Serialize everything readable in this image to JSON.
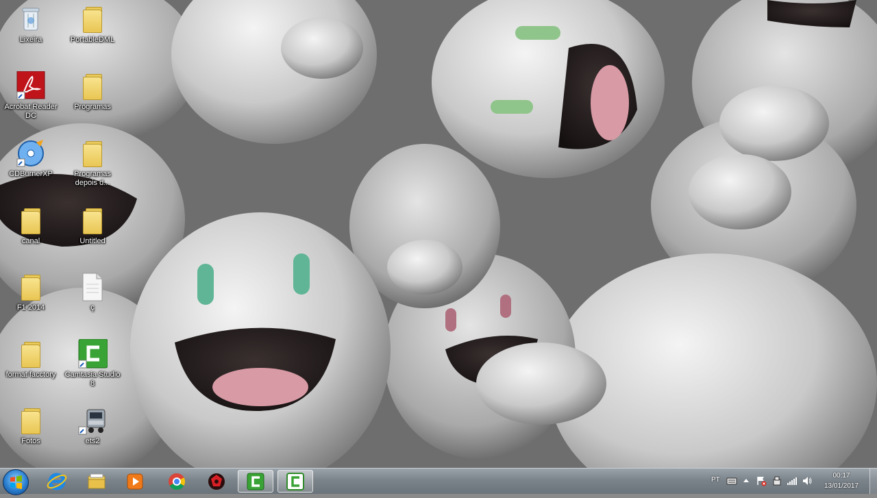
{
  "desktop": {
    "icons": [
      {
        "label": "Lixeira",
        "icon": "recycle-bin-icon"
      },
      {
        "label": "PortableDML",
        "icon": "folder-icon"
      },
      {
        "label": "Acrobat Reader DC",
        "icon": "acrobat-reader-icon"
      },
      {
        "label": "Programas",
        "icon": "folder-icon"
      },
      {
        "label": "CDBurnerXP",
        "icon": "cdburnerxp-icon"
      },
      {
        "label": "Programas depois d...",
        "icon": "folder-icon"
      },
      {
        "label": "canal",
        "icon": "folder-icon"
      },
      {
        "label": "Untitled",
        "icon": "folder-icon"
      },
      {
        "label": "F1 2014",
        "icon": "folder-icon"
      },
      {
        "label": "ç",
        "icon": "document-icon"
      },
      {
        "label": "format facctory",
        "icon": "folder-icon"
      },
      {
        "label": "Camtasia Studio 8",
        "icon": "camtasia-icon"
      },
      {
        "label": "Fotos",
        "icon": "folder-icon"
      },
      {
        "label": "ets2",
        "icon": "truck-icon"
      }
    ]
  },
  "taskbar": {
    "pinned": [
      {
        "name": "internet-explorer-icon"
      },
      {
        "name": "file-explorer-icon"
      },
      {
        "name": "media-player-icon"
      },
      {
        "name": "chrome-icon"
      },
      {
        "name": "app-red-icon"
      },
      {
        "name": "camtasia-recorder-icon"
      },
      {
        "name": "camtasia-studio-icon"
      }
    ],
    "tray": {
      "language": "PT",
      "time": "00:17",
      "date": "13/01/2017"
    },
    "colors": {
      "accent": "#2a7fd0",
      "camtasia": "#3aa335"
    }
  }
}
